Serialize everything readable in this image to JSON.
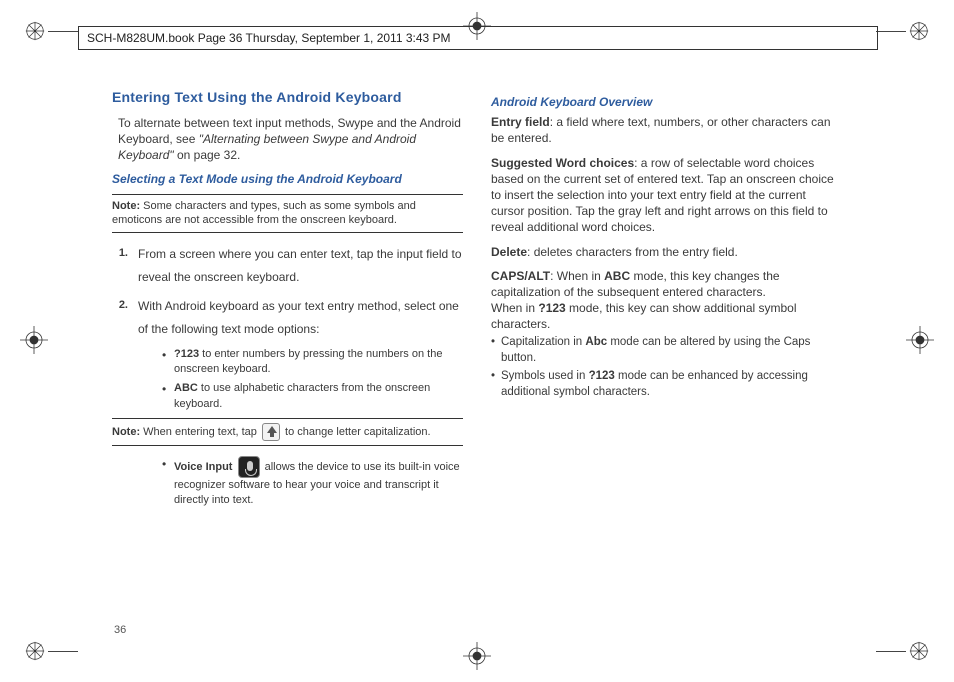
{
  "header": "SCH-M828UM.book  Page 36  Thursday, September 1, 2011  3:43 PM",
  "page_number": "36",
  "left": {
    "h1": "Entering Text Using the Android Keyboard",
    "intro_a": "To alternate between text input methods, Swype and the Android Keyboard, see ",
    "intro_ref": "\"Alternating between Swype and Android Keyboard\"",
    "intro_b": " on page 32.",
    "h2": "Selecting a Text Mode using the Android Keyboard",
    "note1_label": "Note: ",
    "note1_text": "Some characters and types, such as some symbols and emoticons are not accessible from the onscreen keyboard.",
    "step1": "From a screen where you can enter text, tap the input field to reveal the onscreen keyboard.",
    "step2": "With Android keyboard as your text entry method, select one of the following text mode options:",
    "bullet1a_bold": "?123",
    "bullet1a_rest": " to enter numbers by pressing the numbers on the onscreen keyboard.",
    "bullet1b_bold": "ABC",
    "bullet1b_rest": " to use alphabetic characters from the onscreen keyboard.",
    "note2_label": "Note: ",
    "note2_a": "When entering text, tap ",
    "note2_b": " to change letter capitalization.",
    "voice_bold": "Voice Input",
    "voice_rest": " allows the device to use its built-in voice recognizer software to hear your voice and transcript it directly into text."
  },
  "right": {
    "h2": "Android Keyboard Overview",
    "p1_bold": "Entry field",
    "p1_rest": ": a field where text, numbers, or other characters can be entered.",
    "p2_bold": "Suggested Word choices",
    "p2_rest": ": a row of selectable word choices based on the current set of entered text. Tap an onscreen choice to insert the selection into your text entry field at the current cursor position. Tap the gray left and right arrows on this field to reveal additional word choices.",
    "p3_bold": "Delete",
    "p3_rest": ": deletes characters from the entry field.",
    "p4_bold": "CAPS/ALT",
    "p4_a": ": When in ",
    "p4_abc": "ABC",
    "p4_b": " mode, this key changes the capitalization of the subsequent entered characters.",
    "p4_c": "When in ",
    "p4_q123": "?123",
    "p4_d": " mode, this key can show additional symbol characters.",
    "b1_a": "Capitalization in ",
    "b1_abc": "Abc",
    "b1_b": " mode can be altered by using the Caps button.",
    "b2_a": "Symbols used in ",
    "b2_q123": "?123",
    "b2_b": " mode can be enhanced by accessing additional symbol characters."
  }
}
